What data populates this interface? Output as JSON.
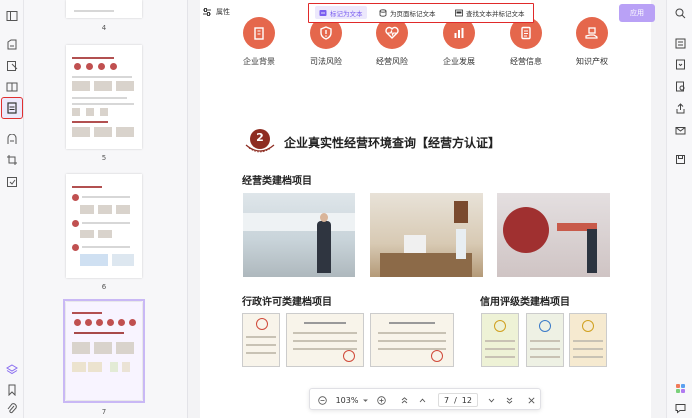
{
  "toolbar": {
    "properties_label": "属性",
    "tag_as_text": "标记为文本",
    "tag_for_page": "为页面标记文本",
    "find_text_and_tag": "查找文本并标记文本",
    "apply_label": "应用"
  },
  "thumbnails": {
    "pages": [
      {
        "number": "4"
      },
      {
        "number": "5"
      },
      {
        "number": "6"
      },
      {
        "number": "7"
      }
    ]
  },
  "document": {
    "icons": [
      {
        "label": "企业背景",
        "icon": "building-icon"
      },
      {
        "label": "司法风险",
        "icon": "alert-shield-icon"
      },
      {
        "label": "经营风险",
        "icon": "heart-pulse-icon"
      },
      {
        "label": "企业发展",
        "icon": "bar-chart-icon"
      },
      {
        "label": "经营信息",
        "icon": "document-list-icon"
      },
      {
        "label": "知识产权",
        "icon": "hand-gift-icon"
      }
    ],
    "section_badge": "2",
    "section_title": "企业真实性经营环境查询【经营方认证】",
    "photos_heading": "经营类建档项目",
    "license_heading": "行政许可类建档项目",
    "credit_heading": "信用评级类建档项目"
  },
  "zoom": {
    "level": "103%",
    "current_page": "7",
    "separator": "/",
    "total_pages": "12"
  },
  "colors": {
    "accent": "#b9a1f6",
    "brand_red": "#e5674c",
    "highlight_border": "#e02a2a"
  }
}
